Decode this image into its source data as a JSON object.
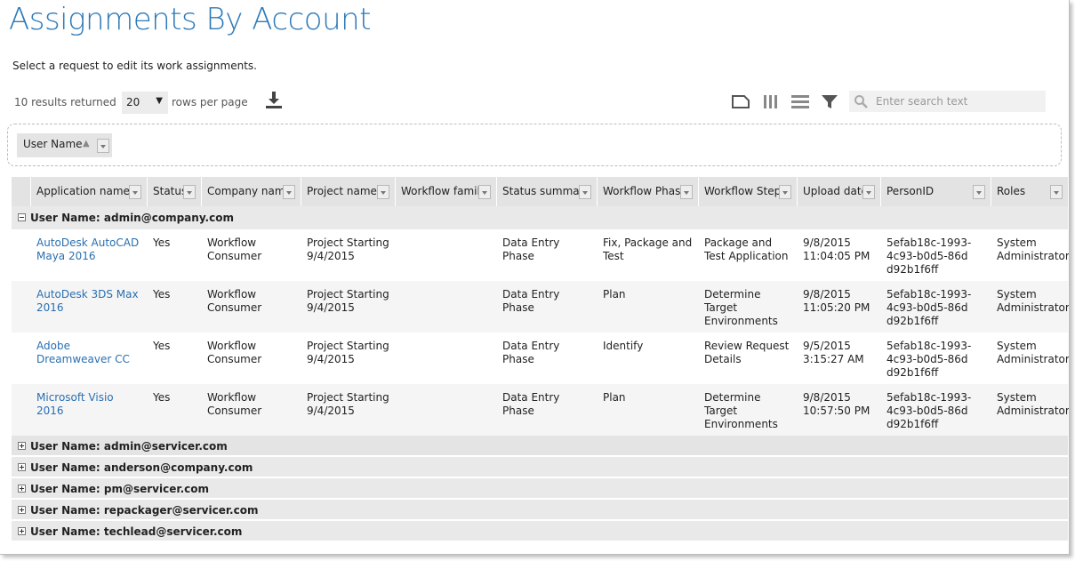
{
  "page": {
    "title": "Assignments By Account",
    "instructions": "Select a request to edit its work assignments."
  },
  "toolbar": {
    "results": "10 results returned",
    "rows_value": "20",
    "rows_label": "rows per page",
    "search_placeholder": "Enter search text",
    "icons": [
      "download-icon",
      "layout-icon",
      "columns-icon",
      "rows-icon",
      "filter-icon",
      "search-icon"
    ]
  },
  "grouping": {
    "chip_label": "User Name",
    "sort": "ascending"
  },
  "columns": [
    "Application name",
    "Status",
    "Company name",
    "Project name",
    "Workflow family",
    "Status summary",
    "Workflow Phase",
    "Workflow Step",
    "Upload date",
    "PersonID",
    "Roles"
  ],
  "groups": [
    {
      "label": "User Name: admin@company.com",
      "expanded": true,
      "rows": [
        {
          "app": "AutoDesk AutoCAD Maya 2016",
          "status": "Yes",
          "company": "Workflow Consumer",
          "project": "Project Starting 9/4/2015",
          "family": "",
          "summary": "Data Entry Phase",
          "phase": "Fix, Package and Test",
          "step": "Package and Test Application",
          "upload": "9/8/2015 11:04:05 PM",
          "person": "5efab18c-1993-4c93-b0d5-86dd92b1f6ff",
          "roles": "System Administrator"
        },
        {
          "app": "AutoDesk 3DS Max 2016",
          "status": "Yes",
          "company": "Workflow Consumer",
          "project": "Project Starting 9/4/2015",
          "family": "",
          "summary": "Data Entry Phase",
          "phase": "Plan",
          "step": "Determine Target Environments",
          "upload": "9/8/2015 11:05:20 PM",
          "person": "5efab18c-1993-4c93-b0d5-86dd92b1f6ff",
          "roles": "System Administrator"
        },
        {
          "app": "Adobe Dreamweaver CC",
          "status": "Yes",
          "company": "Workflow Consumer",
          "project": "Project Starting 9/4/2015",
          "family": "",
          "summary": "Data Entry Phase",
          "phase": "Identify",
          "step": "Review Request Details",
          "upload": "9/5/2015 3:15:27 AM",
          "person": "5efab18c-1993-4c93-b0d5-86dd92b1f6ff",
          "roles": "System Administrator"
        },
        {
          "app": "Microsoft Visio 2016",
          "status": "Yes",
          "company": "Workflow Consumer",
          "project": "Project Starting 9/4/2015",
          "family": "",
          "summary": "Data Entry Phase",
          "phase": "Plan",
          "step": "Determine Target Environments",
          "upload": "9/8/2015 10:57:50 PM",
          "person": "5efab18c-1993-4c93-b0d5-86dd92b1f6ff",
          "roles": "System Administrator"
        }
      ]
    },
    {
      "label": "User Name: admin@servicer.com",
      "expanded": false
    },
    {
      "label": "User Name: anderson@company.com",
      "expanded": false
    },
    {
      "label": "User Name: pm@servicer.com",
      "expanded": false
    },
    {
      "label": "User Name: repackager@servicer.com",
      "expanded": false
    },
    {
      "label": "User Name: techlead@servicer.com",
      "expanded": false
    }
  ],
  "colors": {
    "title": "#2e7ab8",
    "link": "#2a6fb0",
    "header_bg": "#e3e3e3",
    "group_bg": "#e9e9e9"
  }
}
